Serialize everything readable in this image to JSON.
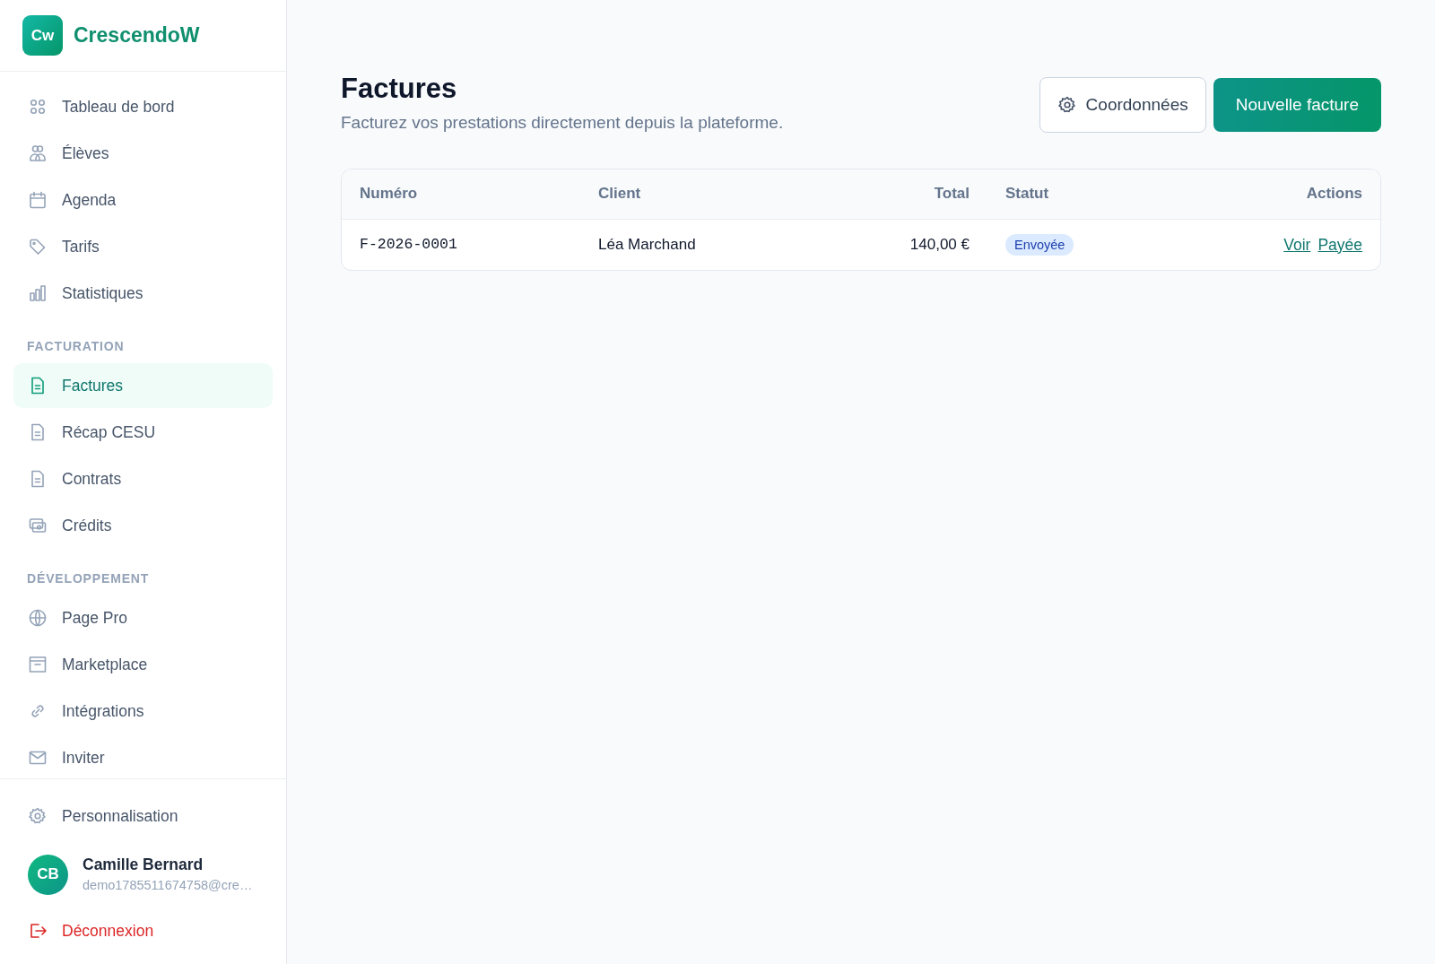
{
  "brand": {
    "logo": "Cw",
    "name": "CrescendoW"
  },
  "nav_sections": [
    {
      "items": [
        {
          "label": "Tableau de bord",
          "selected": false
        },
        {
          "label": "Élèves",
          "selected": false
        },
        {
          "label": "Agenda",
          "selected": false
        },
        {
          "label": "Tarifs",
          "selected": false
        },
        {
          "label": "Statistiques",
          "selected": false
        }
      ]
    },
    {
      "heading": "FACTURATION",
      "items": [
        {
          "label": "Factures",
          "selected": true
        },
        {
          "label": "Récap CESU",
          "selected": false
        },
        {
          "label": "Contrats",
          "selected": false
        },
        {
          "label": "Crédits",
          "selected": false
        }
      ]
    },
    {
      "heading": "DÉVELOPPEMENT",
      "items": [
        {
          "label": "Page Pro",
          "selected": false
        },
        {
          "label": "Marketplace",
          "selected": false
        },
        {
          "label": "Intégrations",
          "selected": false
        },
        {
          "label": "Inviter",
          "selected": false
        }
      ]
    }
  ],
  "settings_link": "Personnalisation",
  "user": {
    "initials": "CB",
    "name": "Camille Bernard",
    "email": "demo1785511674758@cre…"
  },
  "logout": "Déconnexion",
  "page": {
    "title": "Factures",
    "subtitle": "Facturez vos prestations directement depuis la plateforme.",
    "buttons": [
      {
        "label": "Coordonnées",
        "kind": "secondary"
      },
      {
        "label": "Nouvelle facture",
        "kind": "primary"
      }
    ]
  },
  "table": {
    "columns": [
      "Numéro",
      "Client",
      "Total",
      "Statut",
      "Actions"
    ],
    "rows": [
      {
        "number": "F-2026-0001",
        "client": "Léa Marchand",
        "total": "140,00 €",
        "status": "Envoyée",
        "actions": [
          "Voir",
          "Payée"
        ]
      }
    ]
  }
}
